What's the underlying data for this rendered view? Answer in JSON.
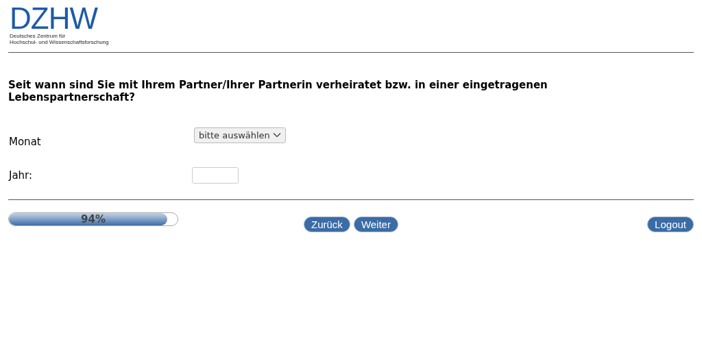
{
  "logo": {
    "wordmark": "DZHW",
    "subtitle_lines": [
      "Deutsches Zentrum für",
      "Hochschul- und Wissenschaftsforschung"
    ]
  },
  "question": "Seit wann sind Sie mit Ihrem Partner/Ihrer Partnerin verheiratet bzw. in einer eingetragenen Lebenspartnerschaft?",
  "fields": [
    {
      "kind": "select",
      "label": "Monat",
      "value": "bitte auswählen"
    },
    {
      "kind": "text",
      "label": "Jahr:"
    }
  ],
  "progress": {
    "level": 0.94,
    "reading": "94%"
  },
  "buttons": [
    "Zurück",
    "Weiter"
  ],
  "logout": "Logout"
}
